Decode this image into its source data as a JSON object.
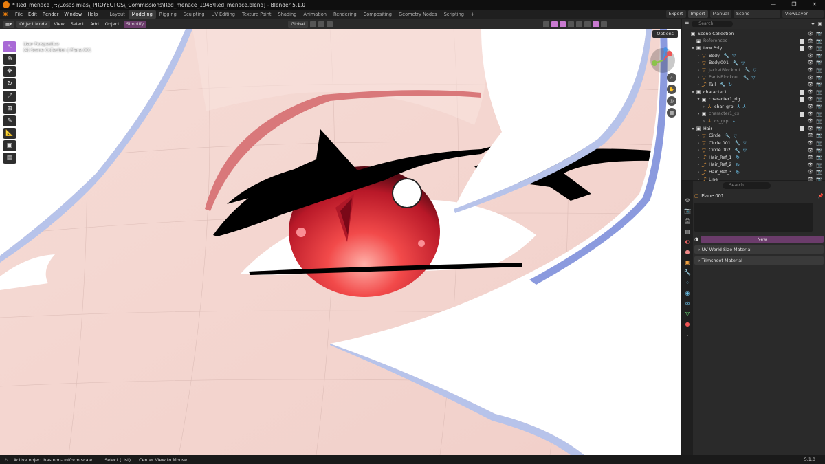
{
  "window": {
    "title": "* Red_menace [F:\\Cosas mias\\_PROYECTOS\\_Commissions\\Red_menace_1945\\Red_menace.blend] - Blender 5.1.0",
    "controls": [
      "—",
      "❐",
      "✕"
    ]
  },
  "menu": {
    "items": [
      "File",
      "Edit",
      "Render",
      "Window",
      "Help"
    ],
    "workspaces": [
      "Layout",
      "Modeling",
      "Rigging",
      "Sculpting",
      "UV Editing",
      "Texture Paint",
      "Shading",
      "Animation",
      "Rendering",
      "Compositing",
      "Geometry Nodes",
      "Scripting"
    ],
    "active_workspace": "Modeling",
    "add_tab": "+",
    "export_label": "Export",
    "import_label": "Import",
    "manual_label": "Manual",
    "scene_label": "Scene",
    "viewlayer_label": "ViewLayer"
  },
  "viewport_header": {
    "mode": "Object Mode",
    "menus": [
      "View",
      "Select",
      "Add",
      "Object"
    ],
    "simplify_label": "Simplify",
    "orientation": "Global",
    "options_label": "Options"
  },
  "viewport": {
    "perspective": "User Perspective",
    "collection_info": "(4) Scene Collection | Plane.001"
  },
  "toolbar": {
    "tools": [
      "select-box",
      "cursor",
      "move",
      "rotate",
      "scale",
      "transform",
      "annotate",
      "measure",
      "add-cube",
      "add-cube-2"
    ]
  },
  "outliner": {
    "search_placeholder": "Search",
    "rows": [
      {
        "label": "Scene Collection",
        "indent": 0,
        "type": "collection",
        "expander": "",
        "dim": false
      },
      {
        "label": "References",
        "indent": 1,
        "type": "collection",
        "expander": "",
        "dim": true
      },
      {
        "label": "Low Poly",
        "indent": 1,
        "type": "collection",
        "expander": "▾",
        "dim": false
      },
      {
        "label": "Body",
        "indent": 2,
        "type": "mesh",
        "expander": "›",
        "dim": false,
        "mods": "🔧 ▽"
      },
      {
        "label": "Body.001",
        "indent": 2,
        "type": "mesh",
        "expander": "›",
        "dim": false,
        "mods": "🔧 ▽"
      },
      {
        "label": "JacketBlockout",
        "indent": 2,
        "type": "mesh",
        "expander": "›",
        "dim": true,
        "mods": "🔧 ▽"
      },
      {
        "label": "PantsBlockout",
        "indent": 2,
        "type": "mesh",
        "expander": "›",
        "dim": true,
        "mods": "🔧 ▽"
      },
      {
        "label": "Tail",
        "indent": 2,
        "type": "curve",
        "expander": "›",
        "dim": false,
        "mods": "🔧 ↻"
      },
      {
        "label": "character1",
        "indent": 1,
        "type": "collection",
        "expander": "▾",
        "dim": false
      },
      {
        "label": "character1_rig",
        "indent": 2,
        "type": "collection",
        "expander": "▾",
        "dim": false
      },
      {
        "label": "char_grp",
        "indent": 3,
        "type": "armature",
        "expander": "›",
        "dim": false,
        "mods": "⅄ ⅄"
      },
      {
        "label": "character1_cs",
        "indent": 2,
        "type": "collection",
        "expander": "▾",
        "dim": true
      },
      {
        "label": "cs_grp",
        "indent": 3,
        "type": "empty",
        "expander": "›",
        "dim": true,
        "mods": "⅄"
      },
      {
        "label": "Hair",
        "indent": 1,
        "type": "collection",
        "expander": "▾",
        "dim": false
      },
      {
        "label": "Circle",
        "indent": 2,
        "type": "mesh",
        "expander": "›",
        "dim": false,
        "mods": "🔧 ▽"
      },
      {
        "label": "Circle.001",
        "indent": 2,
        "type": "mesh",
        "expander": "›",
        "dim": false,
        "mods": "🔧 ▽"
      },
      {
        "label": "Circle.002",
        "indent": 2,
        "type": "mesh",
        "expander": "›",
        "dim": false,
        "mods": "🔧 ▽"
      },
      {
        "label": "Hair_Ref_1",
        "indent": 2,
        "type": "curve",
        "expander": "›",
        "dim": false,
        "mods": "↻"
      },
      {
        "label": "Hair_Ref_2",
        "indent": 2,
        "type": "curve",
        "expander": "›",
        "dim": false,
        "mods": "↻"
      },
      {
        "label": "Hair_Ref_3",
        "indent": 2,
        "type": "curve",
        "expander": "›",
        "dim": false,
        "mods": "↻"
      },
      {
        "label": "Line",
        "indent": 2,
        "type": "curve",
        "expander": "›",
        "dim": false,
        "mods": ""
      }
    ]
  },
  "properties": {
    "search_placeholder": "Search",
    "object_name": "Plane.001",
    "new_label": "New",
    "panels": [
      "UV World Size Material",
      "Trimsheet Material"
    ]
  },
  "statusbar": {
    "message": "Active object has non-uniform scale",
    "select_hint": "Select (List)",
    "center_hint": "Center View to Mouse",
    "version": "5.1.0"
  },
  "colors": {
    "accent_purple": "#a96ad6",
    "blender_orange": "#e87d0d",
    "skin": "#f3d5d0",
    "iris_red": "#e8323c"
  }
}
